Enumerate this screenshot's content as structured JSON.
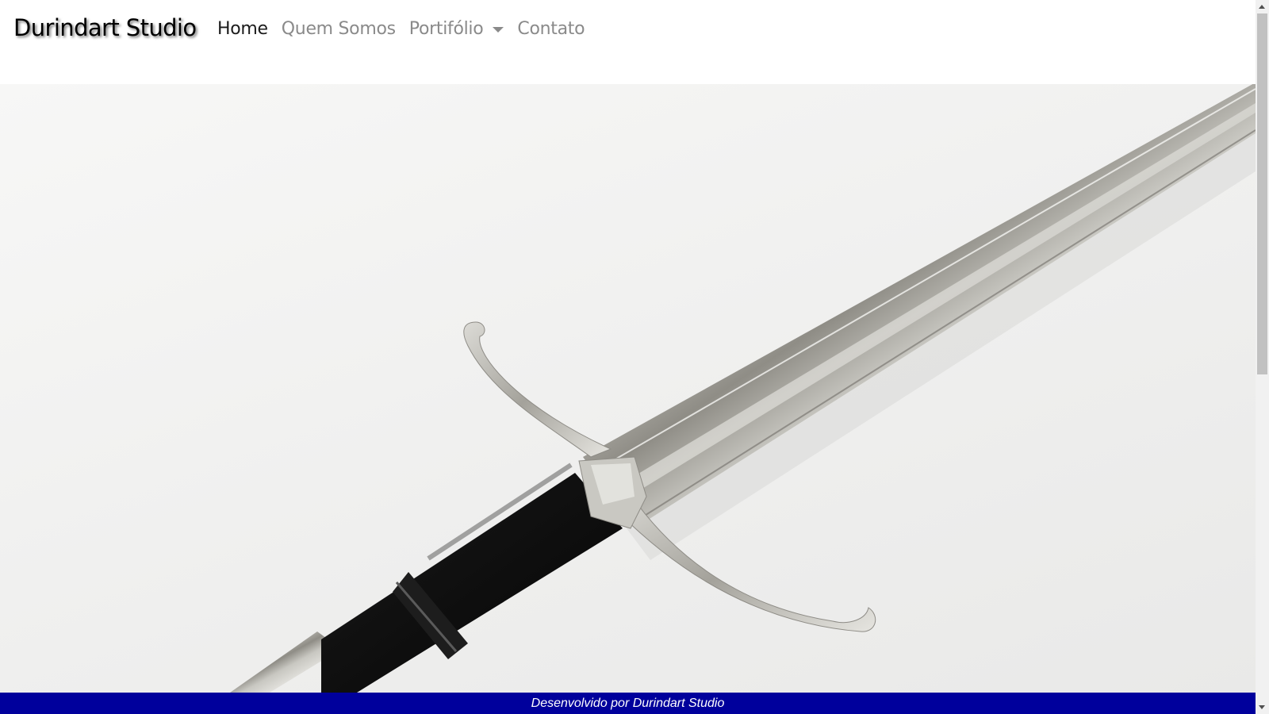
{
  "navbar": {
    "brand": "Durindart Studio",
    "links": [
      {
        "label": "Home",
        "active": true
      },
      {
        "label": "Quem Somos",
        "active": false
      },
      {
        "label": "Portifólio",
        "active": false,
        "dropdown": true
      },
      {
        "label": "Contato",
        "active": false
      }
    ]
  },
  "hero": {
    "image": "longsword-on-white-background"
  },
  "footer": {
    "text": "Desenvolvido por Durindart Studio"
  },
  "colors": {
    "footer_bg": "#00009c",
    "nav_inactive": "#8a8a8a",
    "nav_active": "#1b1b1b"
  }
}
